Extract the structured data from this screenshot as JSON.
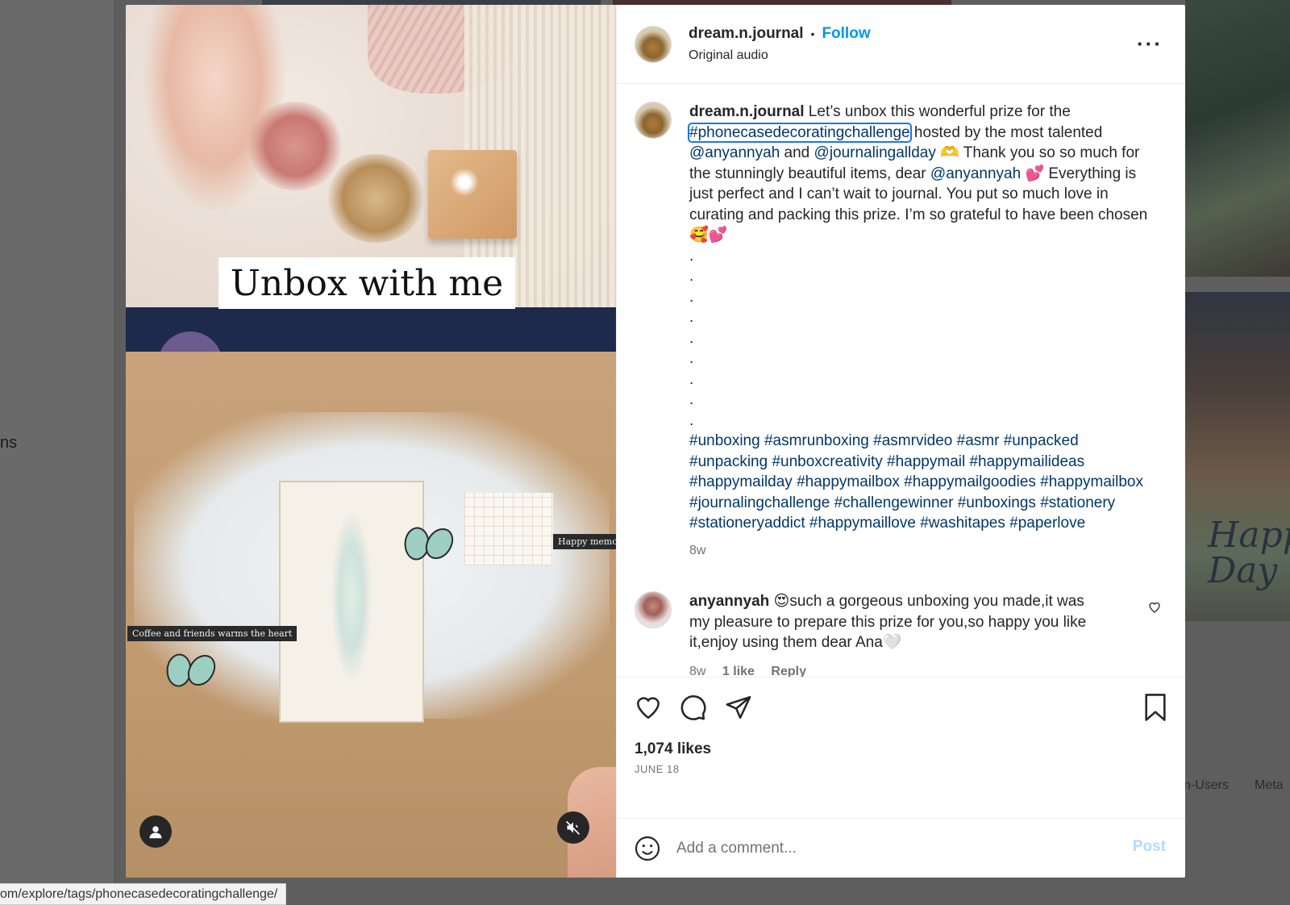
{
  "background": {
    "left_partial_text": "ns",
    "footer_links": [
      "n-Users",
      "Meta"
    ],
    "tile_text": "Happy Day"
  },
  "post": {
    "media": {
      "overlay_text": "Unbox with me",
      "sticker_text_1": "Coffee and friends warms the heart",
      "sticker_text_2": "Happy memo"
    },
    "header": {
      "username": "dream.n.journal",
      "separator": "•",
      "follow_label": "Follow",
      "audio_label": "Original audio",
      "more_icon": "more-options-icon"
    },
    "caption": {
      "username": "dream.n.journal",
      "text_1": " Let’s unbox this wonderful prize for the ",
      "hashtag_highlight": "#phonecasedecoratingchallenge",
      "text_2": " hosted by the most talented ",
      "mention_1": "@anyannyah",
      "text_3": " and ",
      "mention_2": "@journalingallday",
      "text_4": " 🫶 Thank you so so much for the stunningly beautiful items, dear ",
      "mention_3": "@anyannyah",
      "text_5": " 💕 Everything is just perfect and I can’t wait to journal. You put so much love in curating and packing this prize. I’m so grateful to have been chosen 🥰💕",
      "dots": [
        ".",
        ".",
        ".",
        ".",
        ".",
        ".",
        ".",
        ".",
        "."
      ],
      "hashtags": "#unboxing #asmrunboxing #asmrvideo #asmr #unpacked #unpacking #unboxcreativity #happymail #happymailideas #happymailday #happymailbox #happymailgoodies #happymailbox #journalingchallenge #challengewinner #unboxings #stationery #stationeryaddict #happymaillove #washitapes #paperlove",
      "time": "8w"
    },
    "comment": {
      "username": "anyannyah",
      "text": " 😍such a gorgeous unboxing you made,it was my pleasure to prepare this prize for you,so happy you like it,enjoy using them dear Ana🤍",
      "time": "8w",
      "likes": "1 like",
      "reply_label": "Reply"
    },
    "actions": {
      "likes": "1,074 likes",
      "date": "JUNE 18"
    },
    "add_comment": {
      "placeholder": "Add a comment...",
      "post_label": "Post"
    }
  },
  "status_bar": {
    "url": "om/explore/tags/phonecasedecoratingchallenge/"
  },
  "colors": {
    "accent": "#0095f6",
    "link": "#00376b",
    "post_disabled": "#b3dbff",
    "meta_gray": "#737373"
  }
}
